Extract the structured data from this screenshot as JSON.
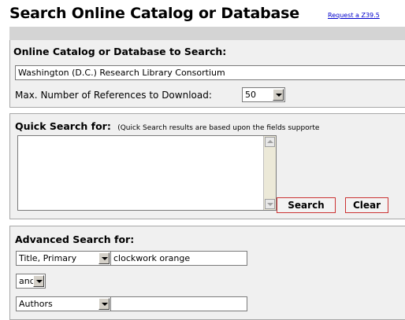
{
  "header": {
    "title": "Search Online Catalog or Database",
    "request_link": "Request a Z39.5"
  },
  "catalog": {
    "heading": "Online Catalog or Database to Search:",
    "selected": "Washington (D.C.) Research Library Consortium",
    "max_label": "Max. Number of References to Download:",
    "max_value": "50"
  },
  "quick": {
    "heading": "Quick Search for:",
    "note": "(Quick Search results are based upon the fields supporte",
    "value": "",
    "search_label": "Search",
    "clear_label": "Clear"
  },
  "advanced": {
    "heading": "Advanced Search for:",
    "rows": [
      {
        "field": "Title, Primary",
        "value": "clockwork orange"
      },
      {
        "operator": "and"
      },
      {
        "field": "Authors",
        "value": ""
      }
    ]
  }
}
